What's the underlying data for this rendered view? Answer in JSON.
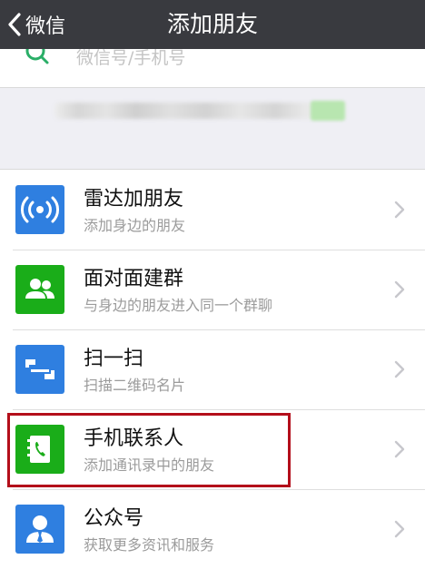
{
  "navbar": {
    "back_label": "微信",
    "title": "添加朋友",
    "background": "#393a3f"
  },
  "search": {
    "placeholder": "微信号/手机号",
    "value": "",
    "icon": "search-icon",
    "icon_color": "#2aae67"
  },
  "menu": {
    "items": [
      {
        "title": "雷达加朋友",
        "subtitle": "添加身边的朋友",
        "icon": "radar-icon",
        "icon_color": "#2f7fe0"
      },
      {
        "title": "面对面建群",
        "subtitle": "与身边的朋友进入同一个群聊",
        "icon": "group-icon",
        "icon_color": "#1aad19"
      },
      {
        "title": "扫一扫",
        "subtitle": "扫描二维码名片",
        "icon": "scan-icon",
        "icon_color": "#2f7fe0"
      },
      {
        "title": "手机联系人",
        "subtitle": "添加通讯录中的朋友",
        "icon": "contacts-book-icon",
        "icon_color": "#1aad19"
      },
      {
        "title": "公众号",
        "subtitle": "获取更多资讯和服务",
        "icon": "official-account-icon",
        "icon_color": "#2f7fe0"
      }
    ]
  },
  "annotation": {
    "highlight_color": "#b30e1a",
    "highlighted_item": "手机联系人"
  }
}
